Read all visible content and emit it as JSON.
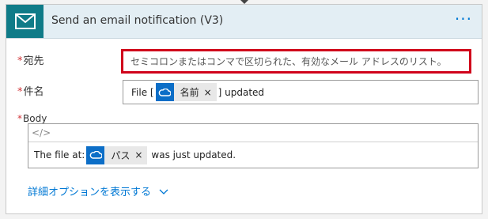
{
  "header": {
    "title": "Send an email notification (V3)",
    "more_label": "···"
  },
  "fields": {
    "to": {
      "label": "宛先",
      "required_mark": "*",
      "placeholder": "セミコロンまたはコンマで区切られた、有効なメール アドレスのリスト。"
    },
    "subject": {
      "label": "件名",
      "required_mark": "*",
      "prefix": "File [",
      "token_label": "名前",
      "suffix": "] updated"
    },
    "body": {
      "label": "Body",
      "required_mark": "*",
      "code_toggle": "</>",
      "prefix": "The file at:",
      "token_label": "パス",
      "suffix": "was just updated."
    }
  },
  "token_close": "×",
  "advanced_options": "詳細オプションを表示する",
  "colors": {
    "header_bg": "#e3eef4",
    "icon_bg": "#0f7b88",
    "token_icon_bg": "#0c6ec7",
    "link": "#0078d4",
    "required": "#d13438",
    "highlight_border": "#d0011b"
  },
  "icons": {
    "header": "mail-icon",
    "token": "onedrive-cloud-icon",
    "advanced": "chevron-down-icon"
  }
}
